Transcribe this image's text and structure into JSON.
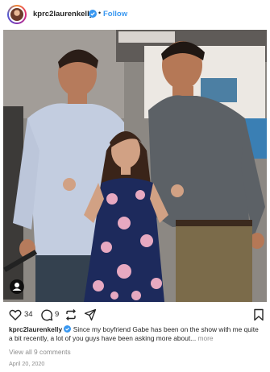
{
  "post": {
    "username": "kprc2laurenkelly",
    "follow_label": "Follow",
    "separator": "•",
    "likes": "34",
    "comments": "9",
    "caption_username": "kprc2laurenkelly",
    "caption_text": "Since my boyfriend Gabe has been on the show with me quite a bit recently, a lot of you guys have been asking more about...",
    "more_label": "more",
    "view_all_comments": "View all 9 comments",
    "date": "April 20, 2020"
  },
  "colors": {
    "link": "#3897f0",
    "text": "#262626",
    "muted": "#8e8e8e"
  },
  "icons": {
    "verified": "verified-badge-icon",
    "like": "heart-outline-icon",
    "comment": "comment-bubble-icon",
    "share": "share-arrows-icon",
    "send": "paper-plane-icon",
    "save": "bookmark-icon",
    "tag": "user-tag-icon"
  }
}
